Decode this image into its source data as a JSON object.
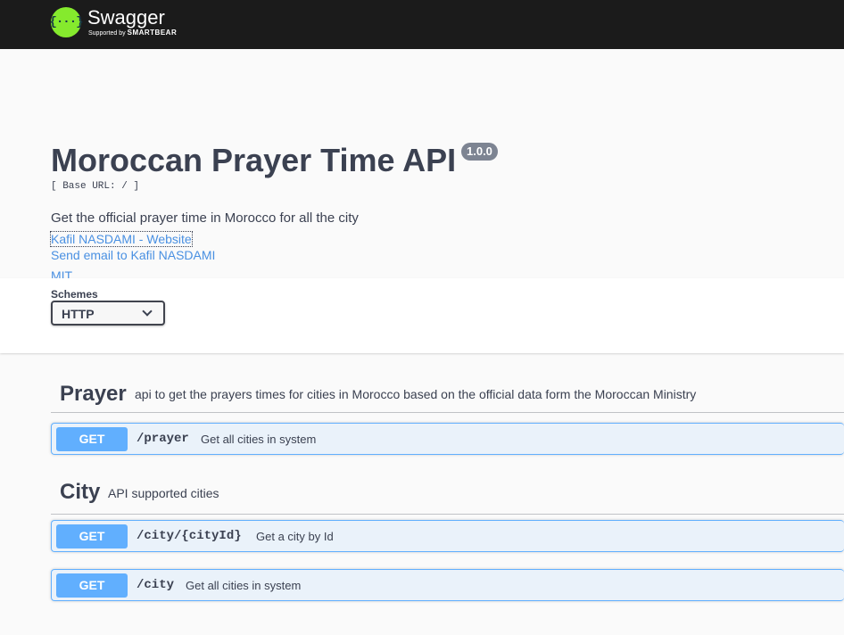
{
  "topbar": {
    "logo_glyph": "{···}",
    "brand": "Swagger",
    "supported_prefix": "Supported by",
    "supported_brand": "SMARTBEAR"
  },
  "info": {
    "title": "Moroccan Prayer Time API",
    "version": "1.0.0",
    "base_url": "[ Base URL: / ]",
    "description": "Get the official prayer time in Morocco for all the city",
    "links": {
      "website": "Kafil NASDAMI - Website",
      "email": "Send email to Kafil NASDAMI",
      "license": "MIT"
    }
  },
  "schemes": {
    "label": "Schemes",
    "selected": "HTTP"
  },
  "tags": [
    {
      "name": "Prayer",
      "description": "api to get the prayers times for cities in Morocco based on the official data form the Moroccan Ministry",
      "operations": [
        {
          "method": "GET",
          "path": "/prayer",
          "summary": "Get all cities in system"
        }
      ]
    },
    {
      "name": "City",
      "description": "API supported cities",
      "operations": [
        {
          "method": "GET",
          "path": "/city/{cityId}",
          "summary": "Get a city by Id"
        },
        {
          "method": "GET",
          "path": "/city",
          "summary": "Get all cities in system"
        }
      ]
    }
  ],
  "colors": {
    "topbar": "#1b1b1b",
    "logo": "#85ea2d",
    "get": "#61affe",
    "link": "#4990e2",
    "text": "#3b4151"
  }
}
